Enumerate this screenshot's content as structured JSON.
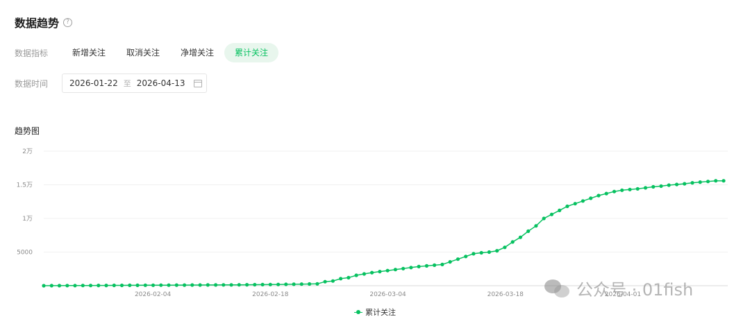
{
  "header": {
    "title": "数据趋势",
    "help_icon": "?"
  },
  "metrics": {
    "label": "数据指标",
    "tabs": [
      {
        "label": "新增关注",
        "active": false
      },
      {
        "label": "取消关注",
        "active": false
      },
      {
        "label": "净增关注",
        "active": false
      },
      {
        "label": "累计关注",
        "active": true
      }
    ]
  },
  "date_filter": {
    "label": "数据时间",
    "start": "2026-01-22",
    "separator": "至",
    "end": "2026-04-13"
  },
  "chart_title": "趋势图",
  "watermark": {
    "text": "公众号 · 01fish"
  },
  "colors": {
    "accent": "#07c160",
    "active_tab_bg": "#e8f6ed"
  },
  "chart_data": {
    "type": "line",
    "x_start": "2026-01-22",
    "x_end": "2026-04-13",
    "xticks": [
      "2026-02-04",
      "2026-02-18",
      "2026-03-04",
      "2026-03-18",
      "2026-04-01"
    ],
    "yticks": [
      {
        "value": 5000,
        "label": "5000"
      },
      {
        "value": 10000,
        "label": "1万"
      },
      {
        "value": 15000,
        "label": "1.5万"
      },
      {
        "value": 20000,
        "label": "2万"
      }
    ],
    "ylim": [
      0,
      20000
    ],
    "legend": "累计关注",
    "series": [
      {
        "name": "累计关注",
        "color": "#07c160",
        "values": [
          5,
          10,
          15,
          20,
          25,
          30,
          35,
          40,
          45,
          50,
          55,
          60,
          65,
          70,
          75,
          80,
          85,
          90,
          95,
          100,
          105,
          110,
          115,
          120,
          125,
          130,
          140,
          150,
          160,
          175,
          190,
          205,
          220,
          240,
          260,
          280,
          600,
          700,
          1050,
          1200,
          1550,
          1750,
          1950,
          2100,
          2250,
          2400,
          2550,
          2700,
          2850,
          2950,
          3050,
          3150,
          3550,
          3950,
          4350,
          4750,
          4900,
          5000,
          5200,
          5700,
          6500,
          7200,
          8100,
          8900,
          10000,
          10600,
          11200,
          11800,
          12200,
          12600,
          13000,
          13400,
          13700,
          14000,
          14200,
          14300,
          14400,
          14550,
          14700,
          14800,
          14950,
          15050,
          15150,
          15300,
          15400,
          15500,
          15600,
          15600
        ]
      }
    ]
  }
}
